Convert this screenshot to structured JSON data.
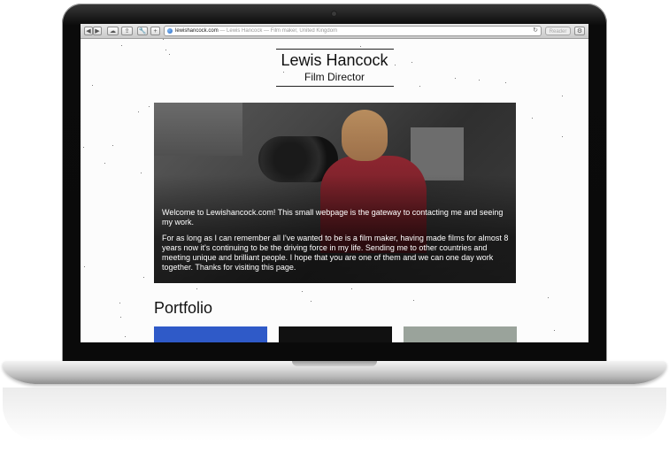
{
  "browser": {
    "url_domain": "lewishancock.com",
    "url_rest": " — Lewis Hancock — Film maker, United Kingdom",
    "reader_label": "Reader",
    "reload_glyph": "↻",
    "buttons": [
      "◀",
      "▶",
      "☁",
      "⇪",
      "🔧",
      "+"
    ],
    "settings_glyph": "⚙"
  },
  "header": {
    "name": "Lewis Hancock",
    "role": "Film Director"
  },
  "hero": {
    "paragraphs": [
      "Welcome to Lewishancock.com! This small webpage is the gateway to contacting me and seeing my work.",
      "For as long as I can remember all I've wanted to be is a film maker, having made films for almost 8 years now it's continuing to be the driving force in my life. Sending me to other countries and meeting unique and brilliant people. I hope that you are one of them and we can one day work together. Thanks for visiting this page."
    ]
  },
  "portfolio": {
    "title": "Portfolio",
    "thumb_colors": [
      "#2f5ac8",
      "#111111",
      "#9aa39b"
    ]
  },
  "colors": {
    "thumb_blue": "#2f5ac8",
    "thumb_dark": "#111111",
    "thumb_grey": "#9aa39b"
  }
}
